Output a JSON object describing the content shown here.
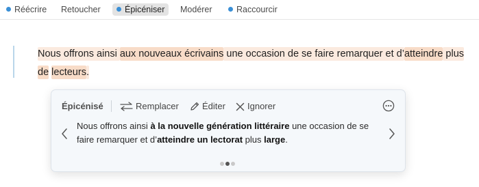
{
  "toolbar": {
    "tabs": [
      {
        "label": "Réécrire",
        "dot": true,
        "active": false
      },
      {
        "label": "Retoucher",
        "dot": false,
        "active": false
      },
      {
        "label": "Épicéniser",
        "dot": true,
        "active": true
      },
      {
        "label": "Modérer",
        "dot": false,
        "active": false
      },
      {
        "label": "Raccourcir",
        "dot": true,
        "active": false
      }
    ]
  },
  "document": {
    "parts": [
      {
        "text": "Nous offrons ainsi ",
        "highlight": "light"
      },
      {
        "text": "aux nouveaux écrivains",
        "highlight": "strong"
      },
      {
        "text": " une occasion de se faire remarquer et d’",
        "highlight": "light"
      },
      {
        "text": "atteindre",
        "highlight": "strong"
      },
      {
        "text": " plus ",
        "highlight": "light"
      },
      {
        "text": "de",
        "highlight": "strong"
      },
      {
        "text": " ",
        "highlight": "none"
      },
      {
        "text": "lecteurs",
        "highlight": "strong"
      },
      {
        "text": ".",
        "highlight": "light"
      }
    ]
  },
  "card": {
    "title": "Épicénisé",
    "actions": {
      "replace_label": "Remplacer",
      "edit_label": "Éditer",
      "ignore_label": "Ignorer"
    },
    "suggestion": [
      {
        "text": "Nous offrons ainsi ",
        "bold": false
      },
      {
        "text": "à la nouvelle génération littéraire",
        "bold": true
      },
      {
        "text": " une occasion de se faire remarquer et d’",
        "bold": false
      },
      {
        "text": "atteindre un lectorat",
        "bold": true
      },
      {
        "text": " plus ",
        "bold": false
      },
      {
        "text": "large",
        "bold": true
      },
      {
        "text": ".",
        "bold": false
      }
    ],
    "pagination": {
      "total": 3,
      "current": 2
    }
  },
  "colors": {
    "accent_dot": "#3a8fd6",
    "highlight_light": "#fbeadf",
    "highlight_strong": "#f8dcc8",
    "quote_bar": "#b9d6ea"
  },
  "icons": {
    "replace": "swap-arrows-icon",
    "edit": "pencil-icon",
    "ignore": "close-icon",
    "more": "more-horizontal-circle-icon",
    "prev": "chevron-left-icon",
    "next": "chevron-right-icon"
  }
}
